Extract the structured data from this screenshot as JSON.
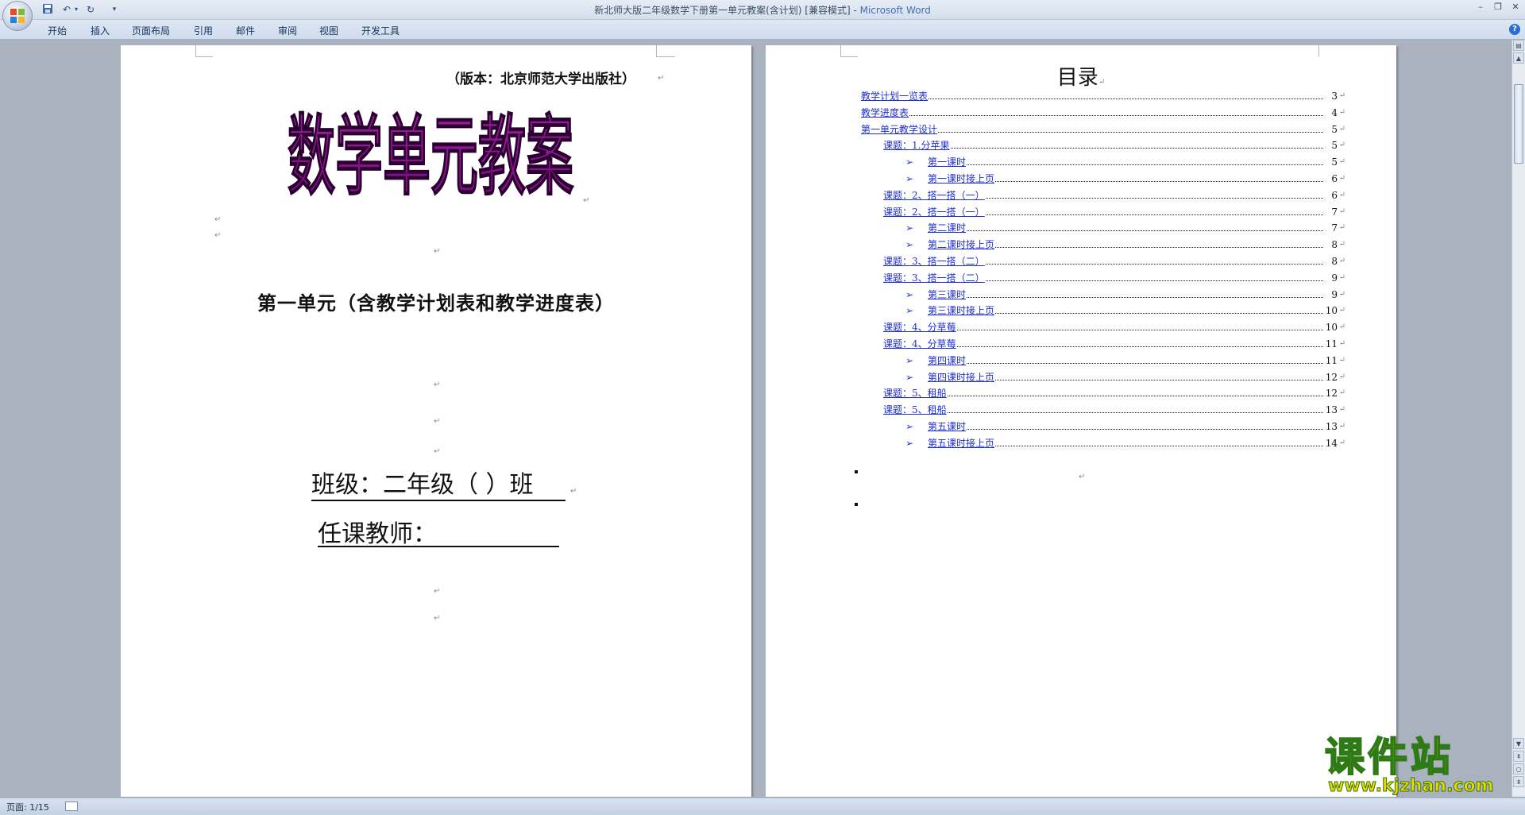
{
  "window": {
    "title": "新北师大版二年级数学下册第一单元教案(含计划) [兼容模式]",
    "title_sep": " - ",
    "app_name": "Microsoft Word"
  },
  "ribbon": {
    "tabs": [
      "开始",
      "插入",
      "页面布局",
      "引用",
      "邮件",
      "审阅",
      "视图",
      "开发工具"
    ]
  },
  "icons": {
    "office_button": "office-logo-icon",
    "save": "save-icon",
    "undo": "undo-icon",
    "redo": "redo-icon",
    "customize": "dropdown-icon",
    "help": "help-icon"
  },
  "page1": {
    "edition": "（版本：北京师范大学出版社）",
    "big_title": "数学单元教案",
    "big_title_color": "#7a0a7a",
    "unit_title": "第一单元（含教学计划表和教学进度表）",
    "class_line": "班级：二年级（   ）班",
    "teacher_line": "任课教师："
  },
  "page2": {
    "toc_title": "目录",
    "toc": [
      {
        "text": "教学计划一览表",
        "page": "3",
        "level": 0
      },
      {
        "text": "教学进度表",
        "page": "4",
        "level": 0
      },
      {
        "text": "第一单元教学设计",
        "page": "5",
        "level": 0
      },
      {
        "text": "课题：1.分苹果",
        "page": "5",
        "level": 1
      },
      {
        "text": "第一课时",
        "page": "5",
        "level": 2
      },
      {
        "text": "第一课时接上页",
        "page": "6",
        "level": 2
      },
      {
        "text": "课题：2、搭一搭（一）",
        "page": "6",
        "level": 1
      },
      {
        "text": "课题：2、搭一搭（一）",
        "page": "7",
        "level": 1
      },
      {
        "text": "第二课时",
        "page": "7",
        "level": 2
      },
      {
        "text": "第二课时接上页",
        "page": "8",
        "level": 2
      },
      {
        "text": "课题：3、搭一搭（二）",
        "page": "8",
        "level": 1
      },
      {
        "text": "课题：3、搭一搭（二）",
        "page": "9",
        "level": 1
      },
      {
        "text": "第三课时",
        "page": "9",
        "level": 2
      },
      {
        "text": "第三课时接上页",
        "page": "10",
        "level": 2
      },
      {
        "text": "课题：4、分草莓",
        "page": "10",
        "level": 1
      },
      {
        "text": "课题：4、分草莓",
        "page": "11",
        "level": 1
      },
      {
        "text": "第四课时",
        "page": "11",
        "level": 2
      },
      {
        "text": "第四课时接上页",
        "page": "12",
        "level": 2
      },
      {
        "text": "课题：5、租船",
        "page": "12",
        "level": 1
      },
      {
        "text": "课题：5、租船",
        "page": "13",
        "level": 1
      },
      {
        "text": "第五课时",
        "page": "13",
        "level": 2
      },
      {
        "text": "第五课时接上页",
        "page": "14",
        "level": 2
      }
    ],
    "arrow": "➢"
  },
  "status": {
    "page": "页面: 1/15"
  },
  "watermark": {
    "main": "课件站",
    "url": "www.kjzhan.com"
  }
}
